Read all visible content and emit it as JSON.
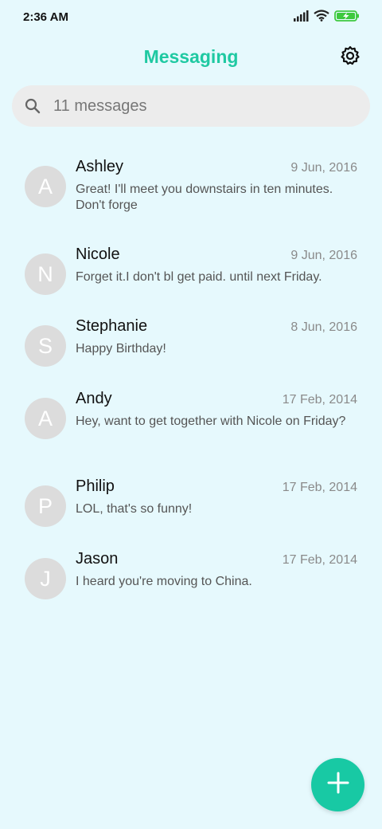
{
  "status_bar": {
    "time": "2:36 AM"
  },
  "header": {
    "title": "Messaging"
  },
  "search": {
    "placeholder": "11 messages"
  },
  "conversations": [
    {
      "initial": "A",
      "name": "Ashley",
      "date": "9 Jun, 2016",
      "preview": "Great! I'll meet you downstairs in ten minutes. Don't forge"
    },
    {
      "initial": "N",
      "name": "Nicole",
      "date": "9 Jun, 2016",
      "preview": "Forget it.I don't bl get paid. until next Friday."
    },
    {
      "initial": "S",
      "name": "Stephanie",
      "date": "8 Jun, 2016",
      "preview": "Happy Birthday!"
    },
    {
      "initial": "A",
      "name": "Andy",
      "date": "17 Feb, 2014",
      "preview": "Hey, want to get together with Nicole on Friday?"
    },
    {
      "initial": "P",
      "name": "Philip",
      "date": "17 Feb, 2014",
      "preview": "LOL, that's so funny!"
    },
    {
      "initial": "J",
      "name": "Jason",
      "date": "17 Feb, 2014",
      "preview": "I heard you're moving to China."
    }
  ],
  "colors": {
    "accent": "#1fc9a2",
    "background": "#e6f9fd",
    "fab": "#18c9a4",
    "battery": "#3ec93e"
  },
  "icons": {
    "settings": "gear-icon",
    "search": "search-icon",
    "fab": "plus-icon"
  }
}
